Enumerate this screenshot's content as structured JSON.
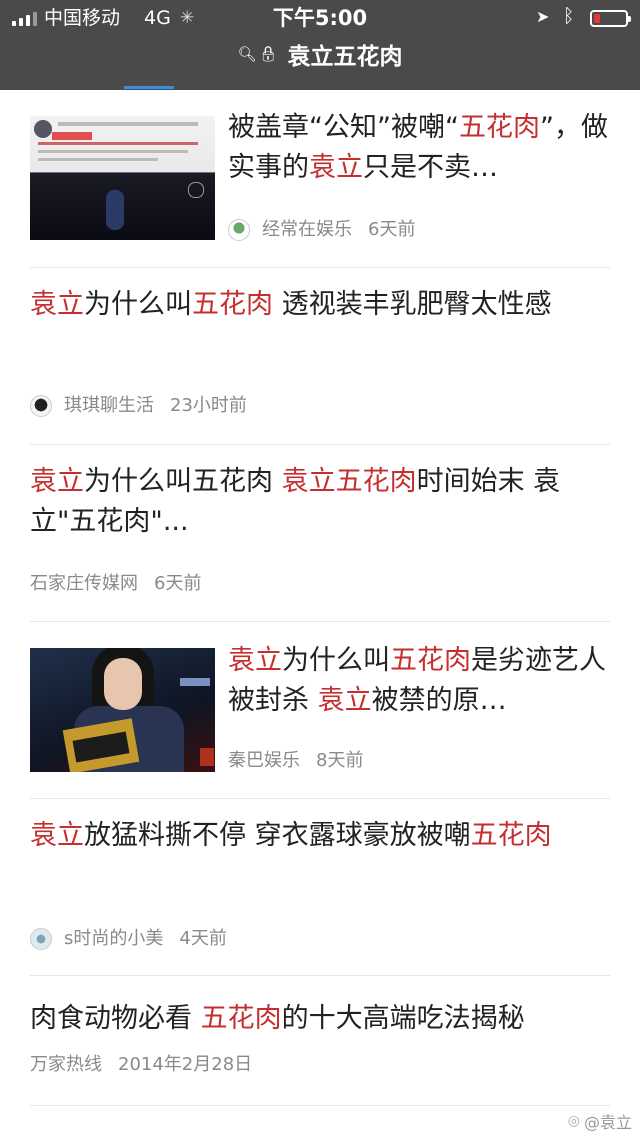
{
  "status_bar": {
    "carrier": "中国移动",
    "network": "4G",
    "time": "下午5:00",
    "battery_level_fraction": 0.2,
    "battery_color": "#e53935"
  },
  "url_bar": {
    "title": "袁立五花肉"
  },
  "colors": {
    "keyword": "#c62f2f",
    "accent_tab": "#3a8ee6"
  },
  "results": [
    {
      "title_parts": [
        {
          "text": "被盖章“公知”被嘲“",
          "hl": false
        },
        {
          "text": "五花肉",
          "hl": true
        },
        {
          "text": "”，做实事的",
          "hl": false
        },
        {
          "text": "袁立",
          "hl": true
        },
        {
          "text": "只是不卖…",
          "hl": false
        }
      ],
      "source": "经常在娱乐",
      "time": "6天前",
      "has_avatar": true
    },
    {
      "title_parts": [
        {
          "text": "袁立",
          "hl": true
        },
        {
          "text": "为什么叫",
          "hl": false
        },
        {
          "text": "五花肉",
          "hl": true
        },
        {
          "text": " 透视装丰乳肥臀太性感",
          "hl": false
        }
      ],
      "source": "琪琪聊生活",
      "time": "23小时前",
      "has_avatar": true
    },
    {
      "title_parts": [
        {
          "text": "袁立",
          "hl": true
        },
        {
          "text": "为什么叫五花肉 ",
          "hl": false
        },
        {
          "text": "袁立五花肉",
          "hl": true
        },
        {
          "text": "时间始末 袁立\"五花肉\"...",
          "hl": false
        }
      ],
      "source": "石家庄传媒网",
      "time": "6天前",
      "has_avatar": false
    },
    {
      "title_parts": [
        {
          "text": "袁立",
          "hl": true
        },
        {
          "text": "为什么叫",
          "hl": false
        },
        {
          "text": "五花肉",
          "hl": true
        },
        {
          "text": "是劣迹艺人被封杀 ",
          "hl": false
        },
        {
          "text": "袁立",
          "hl": true
        },
        {
          "text": "被禁的原…",
          "hl": false
        }
      ],
      "source": "秦巴娱乐",
      "time": "8天前",
      "has_avatar": false
    },
    {
      "title_parts": [
        {
          "text": "袁立",
          "hl": true
        },
        {
          "text": "放猛料撕不停 穿衣露球豪放被嘲",
          "hl": false
        },
        {
          "text": "五花肉",
          "hl": true
        }
      ],
      "source": "s时尚的小美",
      "time": "4天前",
      "has_avatar": true
    },
    {
      "title_parts": [
        {
          "text": "肉食动物必看 ",
          "hl": false
        },
        {
          "text": "五花肉",
          "hl": true
        },
        {
          "text": "的十大高端吃法揭秘",
          "hl": false
        }
      ],
      "source": "万家热线",
      "time": "2014年2月28日",
      "has_avatar": false
    }
  ],
  "watermark": "@袁立"
}
